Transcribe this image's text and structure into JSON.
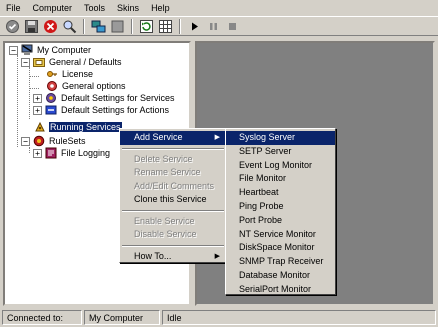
{
  "menubar": [
    "File",
    "Computer",
    "Tools",
    "Skins",
    "Help"
  ],
  "toolbar": [
    "record-icon",
    "save-icon",
    "stop-icon",
    "search-icon",
    "network-icon",
    "blank-icon",
    "refresh-icon",
    "grid-icon",
    "play-icon",
    "pause-icon",
    "stop-square-icon"
  ],
  "tree": {
    "root": "My Computer",
    "general": "General / Defaults",
    "license": "License",
    "general_options": "General options",
    "default_services": "Default Settings for Services",
    "default_actions": "Default Settings for Actions",
    "running_services": "Running Services",
    "rulesets": "RuleSets",
    "file_logging": "File Logging"
  },
  "context_menu": {
    "add_service": "Add Service",
    "delete_service": "Delete Service",
    "rename_service": "Rename Service",
    "add_edit_comments": "Add/Edit Comments",
    "clone_service": "Clone this Service",
    "enable_service": "Enable Service",
    "disable_service": "Disable Service",
    "how_to": "How To..."
  },
  "submenu": [
    "Syslog Server",
    "SETP Server",
    "Event Log Monitor",
    "File Monitor",
    "Heartbeat",
    "Ping Probe",
    "Port Probe",
    "NT Service Monitor",
    "DiskSpace Monitor",
    "SNMP Trap Receiver",
    "Database Monitor",
    "SerialPort Monitor"
  ],
  "status": {
    "connected_label": "Connected to:",
    "computer": "My Computer",
    "state": "Idle"
  },
  "colors": {
    "selection": "#0a246a",
    "face": "#d4d0c8",
    "workspace": "#808080"
  }
}
